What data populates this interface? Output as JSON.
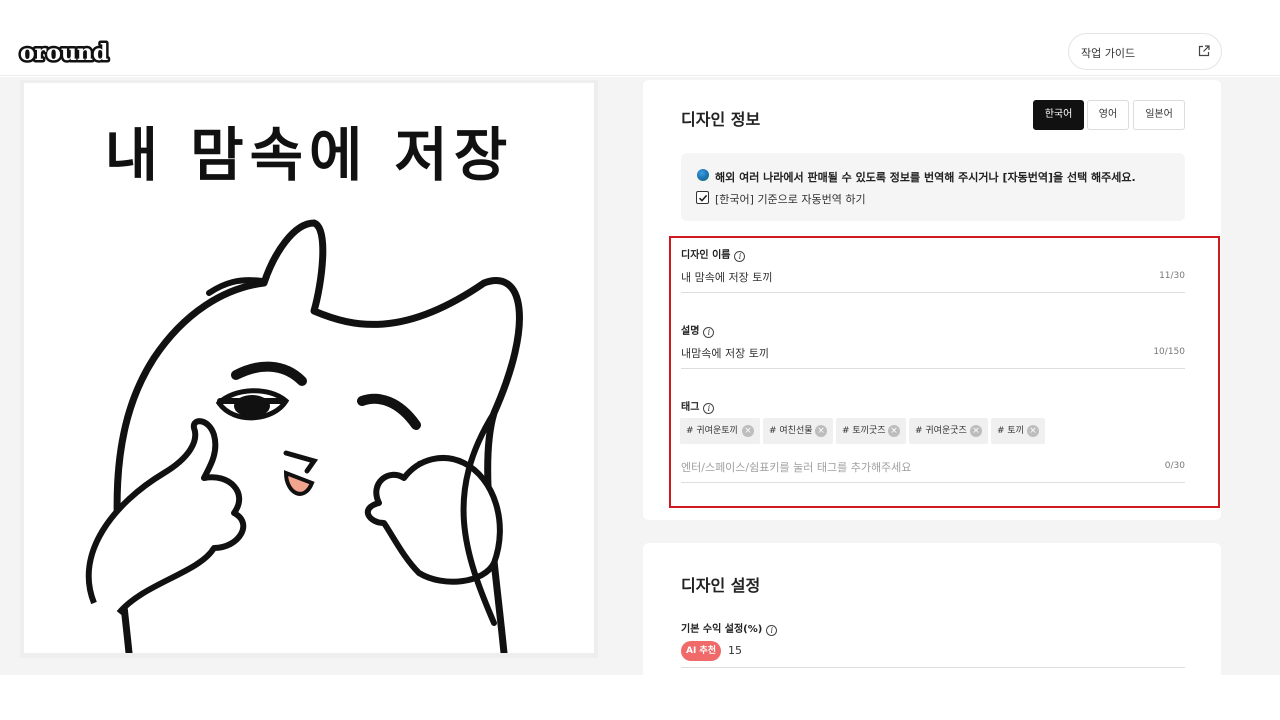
{
  "header": {
    "logo_text": "oround",
    "guide_label": "작업 가이드"
  },
  "artwork": {
    "caption": "내 맘속에 저장"
  },
  "design_info": {
    "title": "디자인 정보",
    "languages": [
      "한국어",
      "영어",
      "일본어"
    ],
    "active_language": "한국어",
    "notice": "해외 여러 나라에서 판매될 수 있도록 정보를 번역해 주시거나 [자동번역]을 선택 해주세요.",
    "auto_translate_label": "[한국어] 기준으로 자동번역 하기",
    "auto_translate_checked": true,
    "name": {
      "label": "디자인 이름",
      "value": "내 맘속에 저장 토끼",
      "count": "11/30"
    },
    "description": {
      "label": "설명",
      "value": "내맘속에 저장 토끼",
      "count": "10/150"
    },
    "tags": {
      "label": "태그",
      "items": [
        "# 귀여운토끼",
        "# 여친선물",
        "# 토끼굿즈",
        "# 귀여운굿즈",
        "# 토끼"
      ],
      "placeholder": "엔터/스페이스/쉼표키를 눌러 태그를 추가해주세요",
      "count": "0/30"
    }
  },
  "design_settings": {
    "title": "디자인 설정",
    "profit_label": "기본 수익 설정(%)",
    "ai_badge": "AI 추천",
    "profit_value": "15"
  },
  "colors": {
    "highlight": "#d0191e",
    "ai_badge": "#f06a6a",
    "active_tab": "#111111"
  }
}
